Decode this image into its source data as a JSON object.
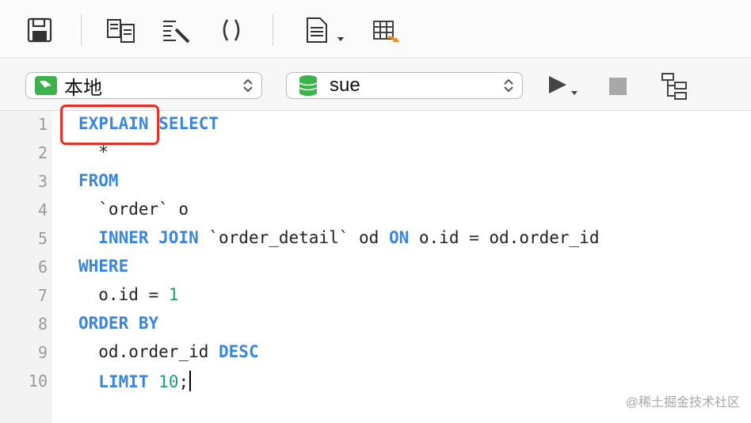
{
  "toolbar": {
    "icons": [
      "save-icon",
      "query-builder-icon",
      "beautify-sql-icon",
      "parentheses-icon",
      "snippet-icon",
      "export-result-icon"
    ]
  },
  "connection": {
    "connection_select": "本地",
    "database_select": "sue",
    "icons": [
      "mysql-dolphin-icon",
      "database-icon",
      "run-icon",
      "stop-icon",
      "explain-tree-icon"
    ]
  },
  "editor": {
    "line_numbers": [
      "1",
      "2",
      "3",
      "4",
      "5",
      "6",
      "7",
      "8",
      "9",
      "10"
    ],
    "lines": [
      "EXPLAIN SELECT",
      "  *",
      "FROM",
      "  `order` o",
      "  INNER JOIN `order_detail` od ON o.id = od.order_id",
      "WHERE",
      "  o.id = 1",
      "ORDER BY",
      "  od.order_id DESC",
      "  LIMIT 10;"
    ]
  },
  "colors": {
    "keyword": "#3a86dc",
    "number": "#1aa370",
    "highlight_box": "#e53228"
  },
  "watermark": "@稀土掘金技术社区"
}
